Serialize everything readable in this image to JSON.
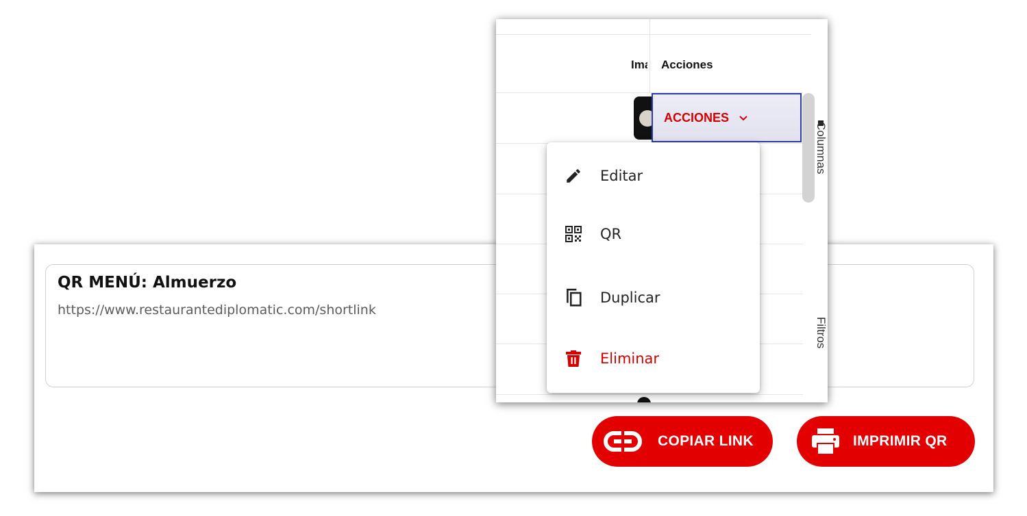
{
  "qr_panel": {
    "title": "QR MENÚ: Almuerzo",
    "url": "https://www.restaurantediplomatic.com/shortlink",
    "copy_link_label": "COPIAR LINK",
    "print_qr_label": "IMPRIMIR QR"
  },
  "table": {
    "headers": [
      "Imagen",
      "Acciones"
    ],
    "actions_button_label": "ACCIONES",
    "side_tabs": [
      "Columnas",
      "Filtros"
    ]
  },
  "actions_menu": {
    "items": [
      {
        "label": "Editar",
        "icon": "pencil-icon"
      },
      {
        "label": "QR",
        "icon": "qr-code-icon"
      },
      {
        "label": "Duplicar",
        "icon": "copy-icon"
      },
      {
        "label": "Eliminar",
        "icon": "trash-icon",
        "color": "#d40000"
      }
    ]
  },
  "colors": {
    "brand_red": "#e20000",
    "danger_red": "#d40000",
    "focus_border": "#2b3aa8"
  }
}
